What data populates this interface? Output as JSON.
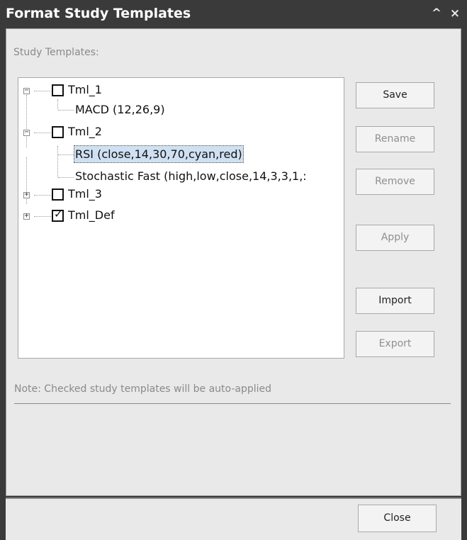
{
  "window": {
    "title": "Format Study Templates",
    "collapse_glyph": "^",
    "close_glyph": "×"
  },
  "section_label": "Study Templates:",
  "tree": [
    {
      "label": "Tml_1",
      "checked": false,
      "expanded": true,
      "expander": "−",
      "children": [
        {
          "label": "MACD (12,26,9)",
          "selected": false
        }
      ]
    },
    {
      "label": "Tml_2",
      "checked": false,
      "expanded": true,
      "expander": "−",
      "children": [
        {
          "label": "RSI (close,14,30,70,cyan,red)",
          "selected": true
        },
        {
          "label": "Stochastic Fast (high,low,close,14,3,3,1,:",
          "selected": false
        }
      ]
    },
    {
      "label": "Tml_3",
      "checked": false,
      "expanded": false,
      "expander": "+"
    },
    {
      "label": "Tml_Def",
      "checked": true,
      "expanded": false,
      "expander": "+",
      "check_glyph": "✓"
    }
  ],
  "buttons": {
    "save": "Save",
    "rename": "Rename",
    "remove": "Remove",
    "apply": "Apply",
    "import": "Import",
    "export": "Export",
    "close": "Close"
  },
  "note": "Note: Checked study templates will be auto-applied",
  "colors": {
    "chrome": "#3a3a3a",
    "panel": "#e9e9e9",
    "selection": "#cfe0f2",
    "disabled_text": "#8f8f8f"
  },
  "icons": [
    "collapse-icon",
    "close-icon",
    "expand-icon",
    "collapse-node-icon",
    "checkbox-icon",
    "checkmark-icon"
  ]
}
